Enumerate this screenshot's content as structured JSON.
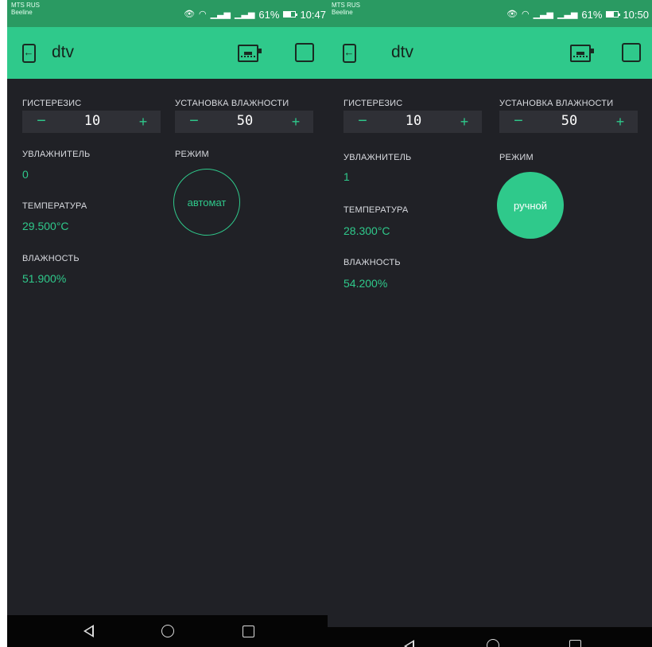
{
  "screens": [
    {
      "status": {
        "carrier1": "MTS RUS",
        "carrier2": "Beeline",
        "battery": "61%",
        "time": "10:47"
      },
      "app": {
        "title": "dtv"
      },
      "hysteresis": {
        "label": "ГИСТЕРЕЗИС",
        "value": "10",
        "minus": "−",
        "plus": "+"
      },
      "humidity_set": {
        "label": "УСТАНОВКА ВЛАЖНОСТИ",
        "value": "50",
        "minus": "−",
        "plus": "+"
      },
      "humidifier": {
        "label": "УВЛАЖНИТЕЛЬ",
        "value": "0"
      },
      "mode": {
        "label": "РЕЖИМ",
        "button": "автомат"
      },
      "temperature": {
        "label": "ТЕМПЕРАТУРА",
        "value": "29.500°C"
      },
      "humidity": {
        "label": "ВЛАЖНОСТЬ",
        "value": "51.900%"
      }
    },
    {
      "status": {
        "carrier1": "MTS RUS",
        "carrier2": "Beeline",
        "battery": "61%",
        "time": "10:50"
      },
      "app": {
        "title": "dtv"
      },
      "hysteresis": {
        "label": "ГИСТЕРЕЗИС",
        "value": "10",
        "minus": "−",
        "plus": "+"
      },
      "humidity_set": {
        "label": "УСТАНОВКА ВЛАЖНОСТИ",
        "value": "50",
        "minus": "−",
        "plus": "+"
      },
      "humidifier": {
        "label": "УВЛАЖНИТЕЛЬ",
        "value": "1"
      },
      "mode": {
        "label": "РЕЖИМ",
        "button": "ручной"
      },
      "temperature": {
        "label": "ТЕМПЕРАТУРА",
        "value": "28.300°C"
      },
      "humidity": {
        "label": "ВЛАЖНОСТЬ",
        "value": "54.200%"
      }
    }
  ],
  "icons": {
    "status": [
      "eye-comfort-icon",
      "wifi-icon",
      "signal-icon",
      "signal-icon",
      "battery-icon"
    ],
    "appbar": [
      "back-icon",
      "device-icon",
      "square-icon"
    ],
    "navbar": [
      "nav-back-icon",
      "nav-home-icon",
      "nav-recent-icon"
    ]
  },
  "colors": {
    "accent": "#2fc98b",
    "statusbar": "#2a9a62",
    "background": "#202126",
    "stepper": "#2f3036",
    "navbar": "#050505"
  }
}
